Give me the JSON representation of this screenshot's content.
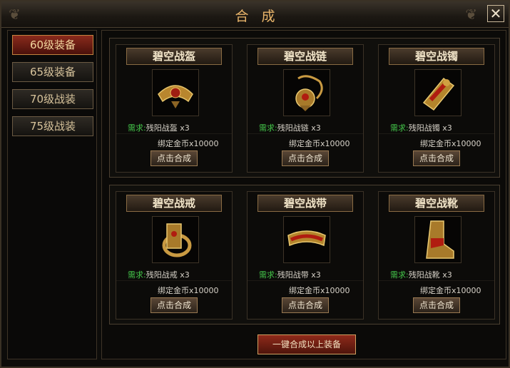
{
  "window": {
    "title": "合成",
    "close_glyph": "✕"
  },
  "sidebar": {
    "tabs": [
      {
        "label": "60级装备",
        "active": true
      },
      {
        "label": "65级装备",
        "active": false
      },
      {
        "label": "70级战装",
        "active": false
      },
      {
        "label": "75级战装",
        "active": false
      }
    ]
  },
  "items": [
    {
      "name": "碧空战盔",
      "icon": "helmet-icon",
      "req_label": "需求:",
      "req_text": "残阳战盔 x3",
      "gold": "绑定金币x10000",
      "button": "点击合成"
    },
    {
      "name": "碧空战链",
      "icon": "necklace-icon",
      "req_label": "需求:",
      "req_text": "残阳战链 x3",
      "gold": "绑定金币x10000",
      "button": "点击合成"
    },
    {
      "name": "碧空战镯",
      "icon": "bracelet-icon",
      "req_label": "需求:",
      "req_text": "残阳战镯 x3",
      "gold": "绑定金币x10000",
      "button": "点击合成"
    },
    {
      "name": "碧空战戒",
      "icon": "ring-icon",
      "req_label": "需求:",
      "req_text": "残阳战戒 x3",
      "gold": "绑定金币x10000",
      "button": "点击合成"
    },
    {
      "name": "碧空战带",
      "icon": "belt-icon",
      "req_label": "需求:",
      "req_text": "残阳战带 x3",
      "gold": "绑定金币x10000",
      "button": "点击合成"
    },
    {
      "name": "碧空战靴",
      "icon": "boots-icon",
      "req_label": "需求:",
      "req_text": "残阳战靴 x3",
      "gold": "绑定金币x10000",
      "button": "点击合成"
    }
  ],
  "footer": {
    "combine_all_label": "一键合成以上装备"
  },
  "colors": {
    "accent": "#e8b46a",
    "requirement_label": "#45c84b",
    "active_tab": "#8a2a1c"
  }
}
